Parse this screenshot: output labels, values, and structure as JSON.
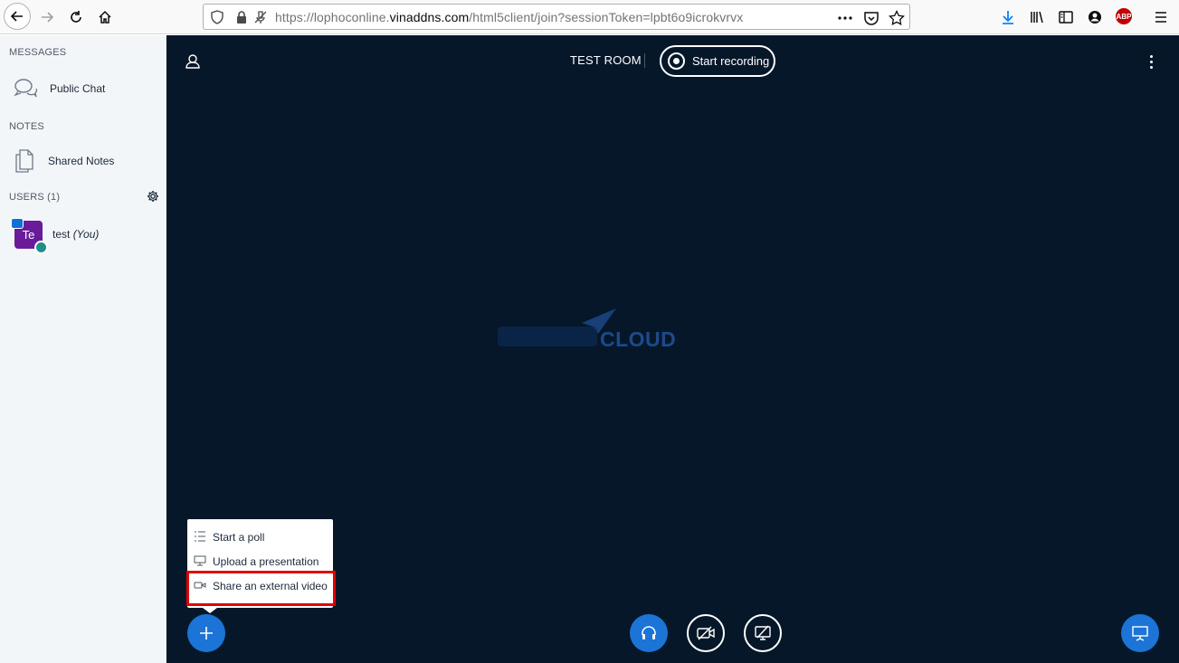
{
  "browser": {
    "url_prefix": "https://lophoconline.",
    "url_domain": "vinaddns.com",
    "url_path": "/html5client/join?sessionToken=lpbt6o9icrokvrvx",
    "abp_label": "ABP"
  },
  "sidebar": {
    "messages_title": "MESSAGES",
    "public_chat_label": "Public Chat",
    "notes_title": "NOTES",
    "shared_notes_label": "Shared Notes",
    "users_title": "USERS (1)",
    "user": {
      "initials": "Te",
      "name": "test",
      "you_label": "(You)"
    }
  },
  "main": {
    "room_title": "TEST ROOM",
    "record_label": "Start recording",
    "logo_text": "CLOUD"
  },
  "actions_menu": {
    "items": [
      {
        "label": "Start a poll",
        "icon": "list-icon"
      },
      {
        "label": "Upload a presentation",
        "icon": "presentation-icon"
      },
      {
        "label": "Share an external video",
        "icon": "video-icon"
      }
    ]
  },
  "colors": {
    "main_bg": "#06172a",
    "accent_blue": "#1b74d6",
    "highlight_red": "#e00000",
    "avatar_purple": "#6a1b9a"
  }
}
